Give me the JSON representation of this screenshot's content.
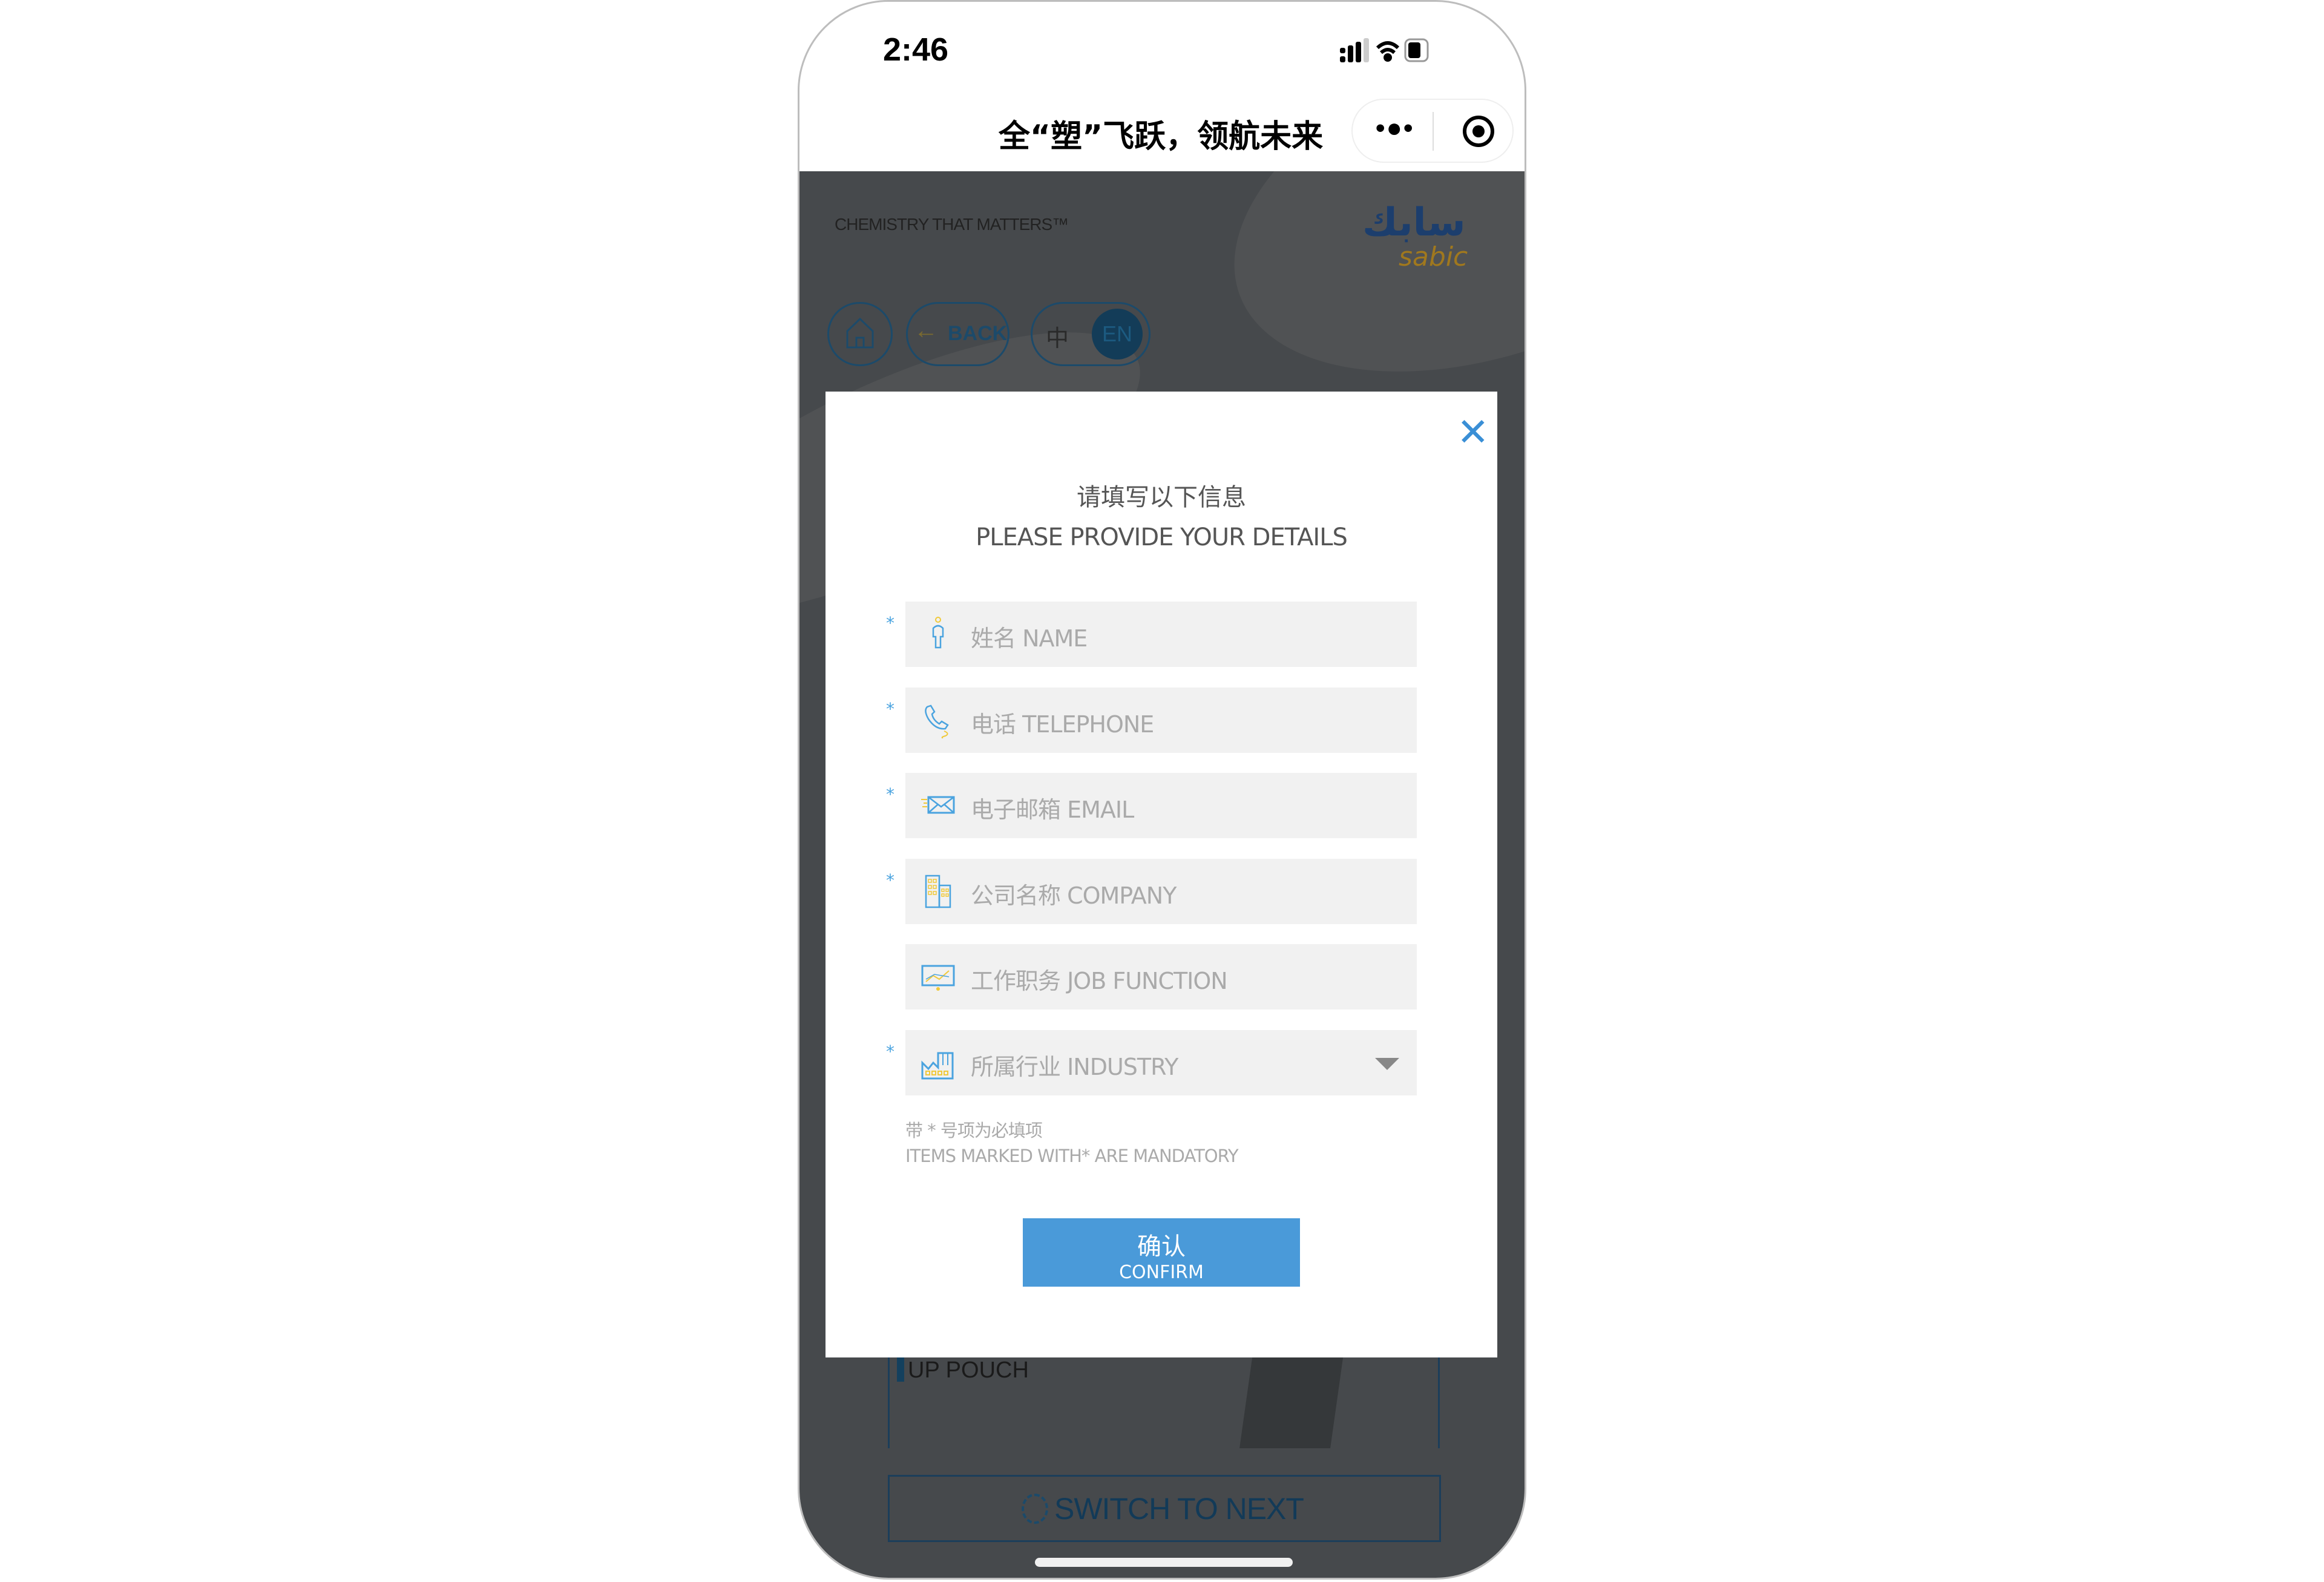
{
  "status_bar": {
    "time": "2:46",
    "signal_icon": "signal-icon",
    "wifi_icon": "wifi-icon",
    "battery_icon": "battery-icon"
  },
  "nav": {
    "title": "全“塑”飞跃，领航未来",
    "more_icon": "more-dots-icon",
    "close_icon": "record-circle-icon"
  },
  "header": {
    "tagline": "CHEMISTRY THAT MATTERS™",
    "logo_arabic": "سابك",
    "logo_latin": "sabic"
  },
  "toolbar": {
    "back_label": "BACK",
    "lang_zh": "中",
    "lang_en": "EN",
    "active_lang": "EN"
  },
  "background": {
    "card_title": "UP POUCH",
    "switch_label": "SWITCH TO NEXT"
  },
  "modal": {
    "title_zh": "请填写以下信息",
    "title_en": "PLEASE PROVIDE YOUR DETAILS",
    "fields": [
      {
        "placeholder": "姓名 NAME",
        "required": true,
        "icon": "person-icon"
      },
      {
        "placeholder": "电话 TELEPHONE",
        "required": true,
        "icon": "phone-icon"
      },
      {
        "placeholder": "电子邮箱 EMAIL",
        "required": true,
        "icon": "envelope-icon"
      },
      {
        "placeholder": "公司名称 COMPANY",
        "required": true,
        "icon": "building-icon"
      },
      {
        "placeholder": "工作职务 JOB FUNCTION",
        "required": false,
        "icon": "presentation-icon"
      },
      {
        "placeholder": "所属行业 INDUSTRY",
        "required": true,
        "icon": "factory-icon"
      }
    ],
    "asterisk": "*",
    "note_zh": "带 * 号项为必填项",
    "note_en": "ITEMS MARKED WITH* ARE MANDATORY",
    "confirm_zh": "确认",
    "confirm_en": "CONFIRM"
  },
  "colors": {
    "accent": "#4a9ad9",
    "icon_blue": "#4aa3df",
    "icon_yellow": "#f0c93a",
    "overlay": "#46494c"
  }
}
